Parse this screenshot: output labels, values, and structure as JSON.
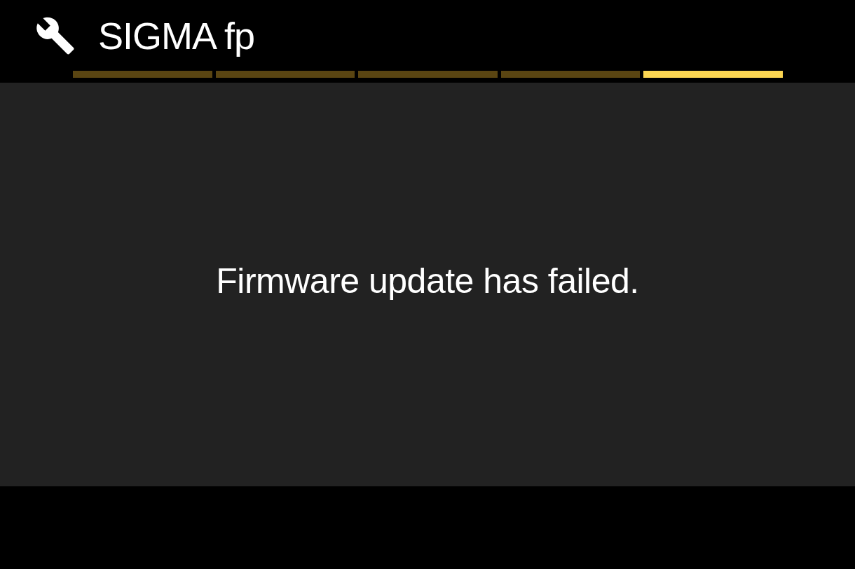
{
  "header": {
    "title": "SIGMA fp"
  },
  "page_indicators": [
    {
      "selected": false
    },
    {
      "selected": false
    },
    {
      "selected": false
    },
    {
      "selected": false
    },
    {
      "selected": true
    }
  ],
  "message": "Firmware update has failed."
}
